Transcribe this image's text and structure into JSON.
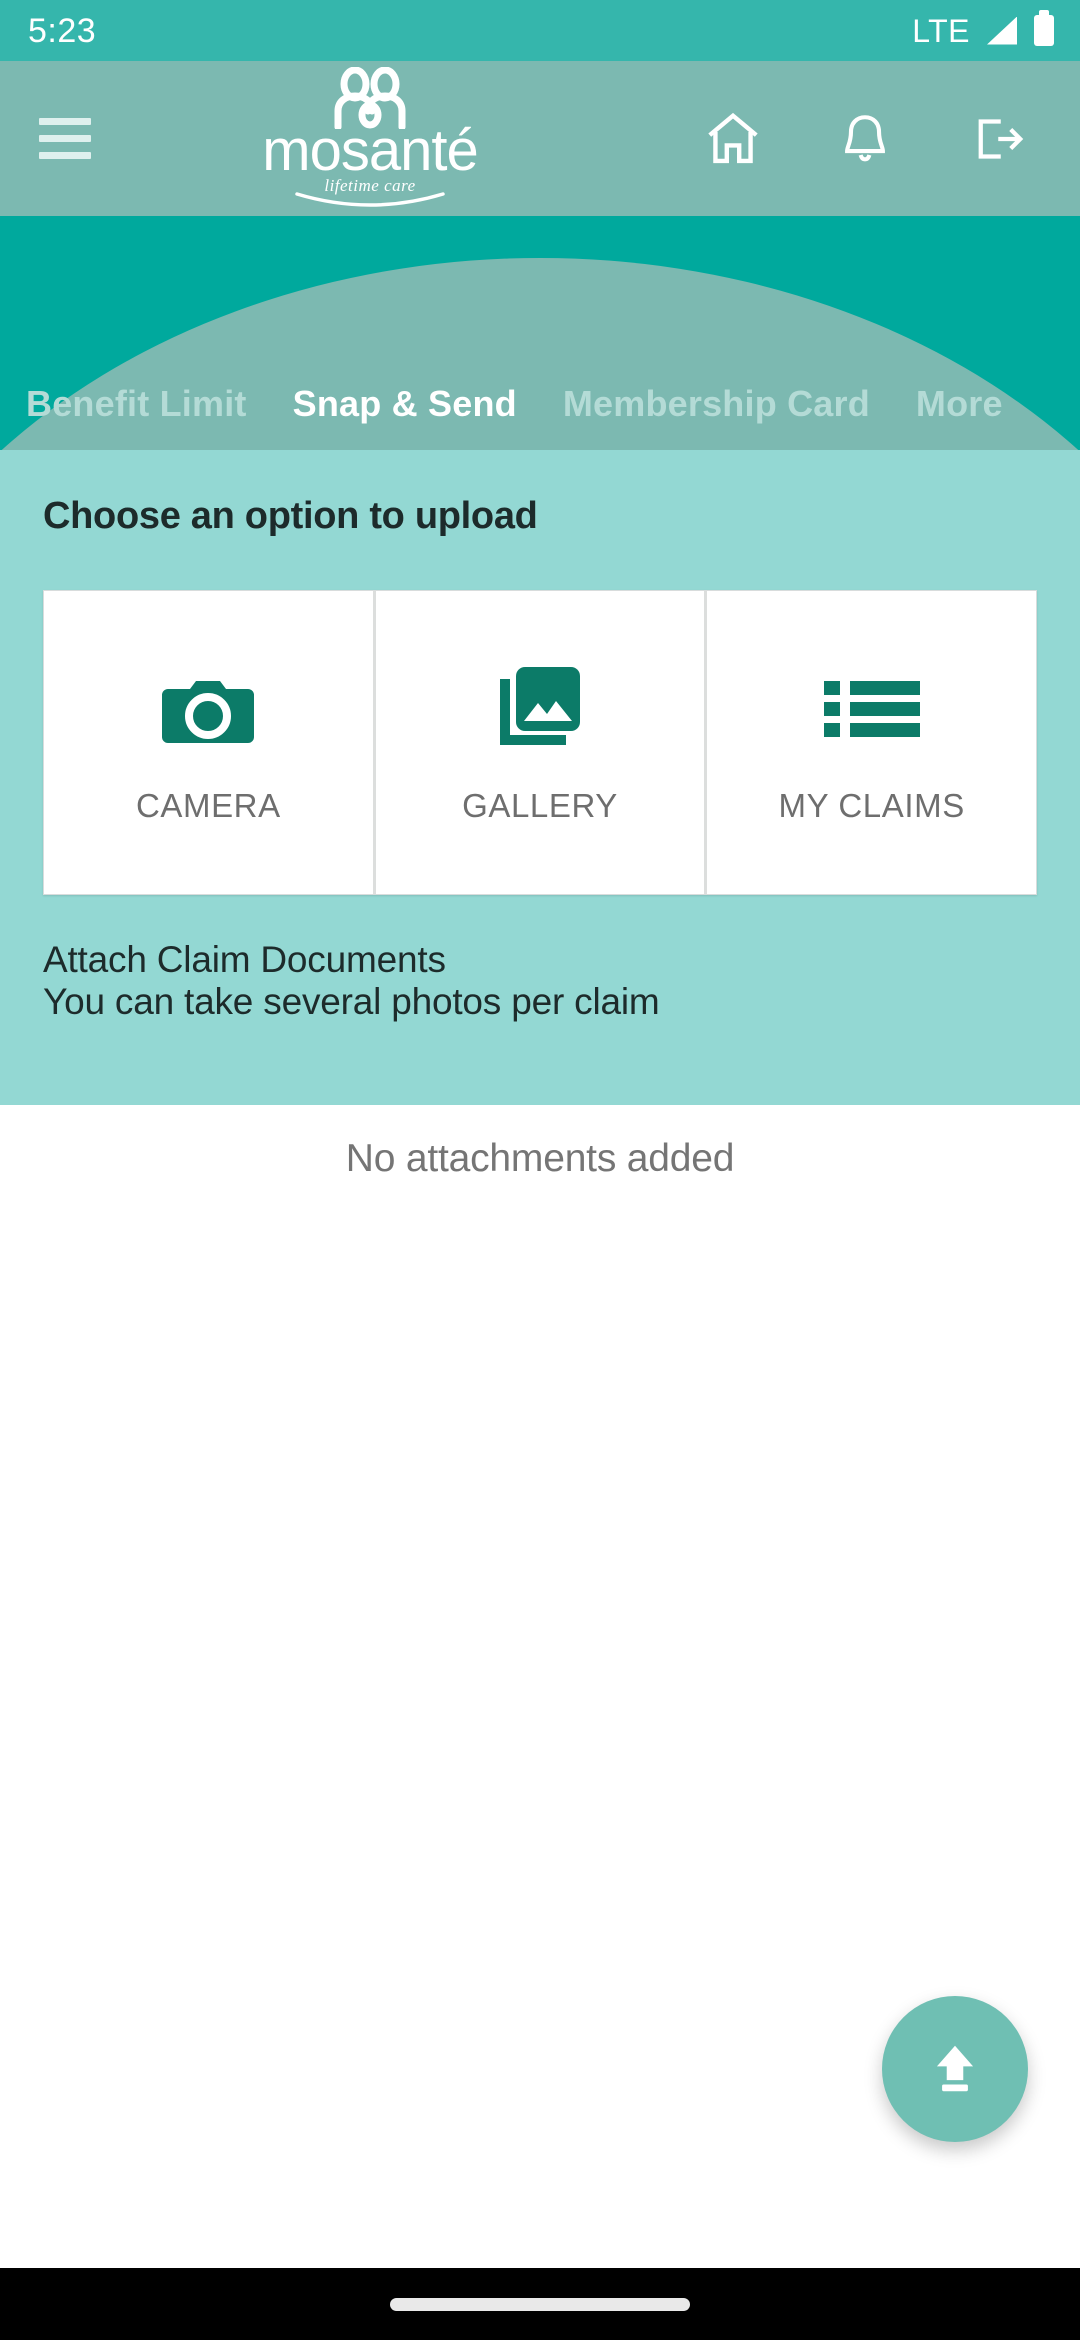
{
  "status_bar": {
    "time": "5:23",
    "network": "LTE",
    "signal_icon": "signal-bars-icon",
    "battery_icon": "battery-full-icon"
  },
  "app_bar": {
    "menu_icon": "hamburger-menu-icon",
    "logo_word": "mosanté",
    "logo_tagline": "lifetime care",
    "logo_mark": "two-people-icon",
    "actions": [
      {
        "name": "home-icon",
        "label": "Home"
      },
      {
        "name": "bell-icon",
        "label": "Notifications"
      },
      {
        "name": "logout-icon",
        "label": "Logout"
      }
    ]
  },
  "tabs": [
    {
      "label": "Benefit Limit",
      "active": false
    },
    {
      "label": "Snap & Send",
      "active": true
    },
    {
      "label": "Membership Card",
      "active": false
    },
    {
      "label": "More",
      "active": false
    }
  ],
  "upload_panel": {
    "title": "Choose an option to upload",
    "options": [
      {
        "label": "CAMERA",
        "icon": "camera-icon"
      },
      {
        "label": "GALLERY",
        "icon": "photo-library-icon"
      },
      {
        "label": "MY CLAIMS",
        "icon": "list-icon"
      }
    ],
    "attach_title": "Attach Claim Documents",
    "attach_subtitle": "You can take several photos per claim"
  },
  "attachments": {
    "empty_message": "No attachments added"
  },
  "fab": {
    "icon": "upload-icon",
    "label": "Upload"
  },
  "nav_bar": {
    "gesture_pill": "home-indicator"
  },
  "colors": {
    "status_bar_teal": "#35b6ac",
    "app_bar_teal": "#7cb9b1",
    "hero_teal": "#00a99d",
    "panel_teal": "#93d8d3",
    "icon_teal": "#0c7b68",
    "fab_teal": "#6fbfb3",
    "active_tab": "#ffffff",
    "inactive_tab": "#b4dbd6"
  }
}
